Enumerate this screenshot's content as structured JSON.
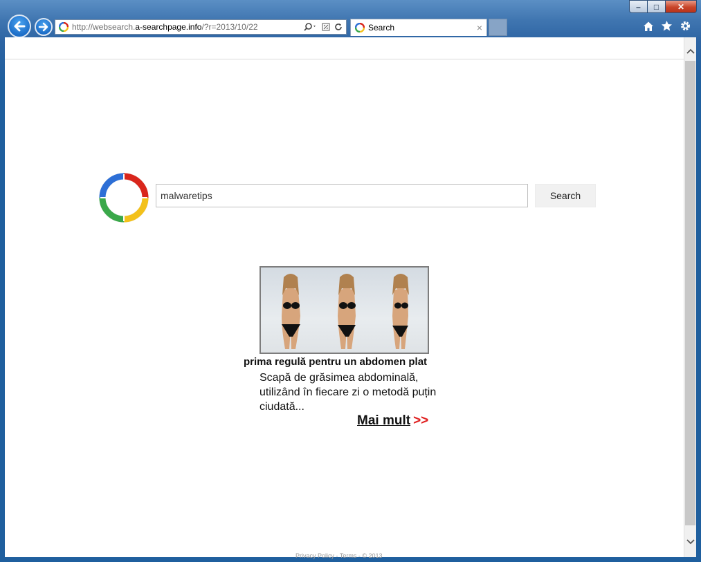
{
  "window": {
    "minimize_label": "–",
    "maximize_label": "□",
    "close_label": "✕"
  },
  "address_bar": {
    "url_prefix": "http://websearch.",
    "url_domain": "a-searchpage.info",
    "url_suffix": "/?r=2013/10/22"
  },
  "tab": {
    "label": "Search",
    "close_label": "×"
  },
  "toolbar_icons": [
    "home-icon",
    "star-icon",
    "gear-icon"
  ],
  "page": {
    "search_value": "malwaretips",
    "search_button_label": "Search",
    "ad": {
      "title": "prima regulă pentru un abdomen plat",
      "body": "Scapă de grăsimea abdominală, utilizând în fiecare zi o metodă puțin ciudată...",
      "more_label": "Mai mult",
      "more_arrows": ">>"
    },
    "footer_fragment": "Privacy Policy  -  Terms  -  © 2013"
  },
  "colors": {
    "accent_blue": "#1d6ec8",
    "ad_link_arrow": "#e02020",
    "logo_red": "#d9261c",
    "logo_yellow": "#f3c11b",
    "logo_green": "#3aa84a",
    "logo_blue": "#2d6fd6"
  }
}
